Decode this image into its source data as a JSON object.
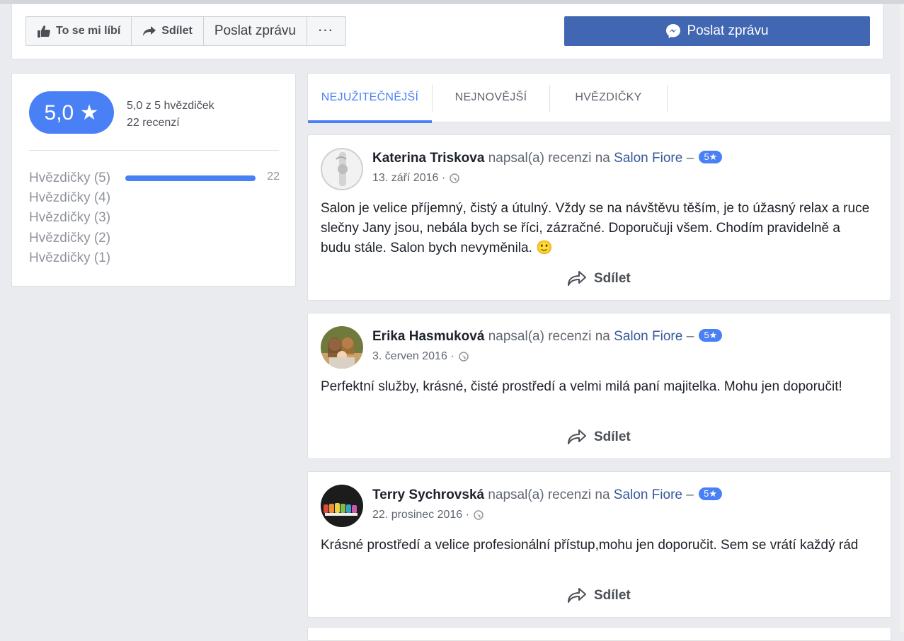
{
  "action_bar": {
    "like_label": "To se mi líbí",
    "share_label": "Sdílet",
    "message_label": "Poslat zprávu",
    "more_label": "···",
    "messenger_label": "Poslat zprávu",
    "accent_color": "#4267b2"
  },
  "rating": {
    "score": "5,0 ★",
    "summary_line": "5,0 z 5 hvězdiček",
    "count_line": "22 recenzí",
    "rows": [
      {
        "label": "Hvězdičky (5)",
        "count": "22",
        "fill": 1.0
      },
      {
        "label": "Hvězdičky (4)",
        "count": "",
        "fill": 0
      },
      {
        "label": "Hvězdičky (3)",
        "count": "",
        "fill": 0
      },
      {
        "label": "Hvězdičky (2)",
        "count": "",
        "fill": 0
      },
      {
        "label": "Hvězdičky (1)",
        "count": "",
        "fill": 0
      }
    ],
    "accent_color": "#4a80f5"
  },
  "tabs": [
    {
      "label": "NEJUŽITEČNĚJŠÍ",
      "active": true
    },
    {
      "label": "NEJNOVĚJŠÍ",
      "active": false
    },
    {
      "label": "HVĚZDIČKY",
      "active": false
    }
  ],
  "reviews": [
    {
      "name": "Katerina Triskova",
      "action": " napsal(a) recenzi na ",
      "page": "Salon Fiore",
      "dash": " – ",
      "stars": "5★",
      "date": "13. září 2016 ·",
      "text": "Salon je velice příjemný, čistý a útulný. Vždy se na návštěvu těším, je to úžasný relax a ruce slečny Jany jsou, nebála bych se říci, zázračné. Doporučuji všem. Chodím pravidelně a budu stále. Salon bych nevyměnila. 🙂",
      "share_label": "Sdílet"
    },
    {
      "name": "Erika Hasmuková",
      "action": " napsal(a) recenzi na ",
      "page": "Salon Fiore",
      "dash": " – ",
      "stars": "5★",
      "date": "3. červen 2016 ·",
      "text": "Perfektní služby, krásné, čisté prostředí a velmi milá paní majitelka. Mohu jen doporučit!",
      "share_label": "Sdílet"
    },
    {
      "name": "Terry Sychrovská",
      "action": " napsal(a) recenzi na ",
      "page": "Salon Fiore",
      "dash": " – ",
      "stars": "5★",
      "date": "22. prosinec 2016 ·",
      "text": "Krásné prostředí a velice profesionální přístup,mohu jen doporučit. Sem se vrátí každý rád",
      "share_label": "Sdílet"
    }
  ]
}
